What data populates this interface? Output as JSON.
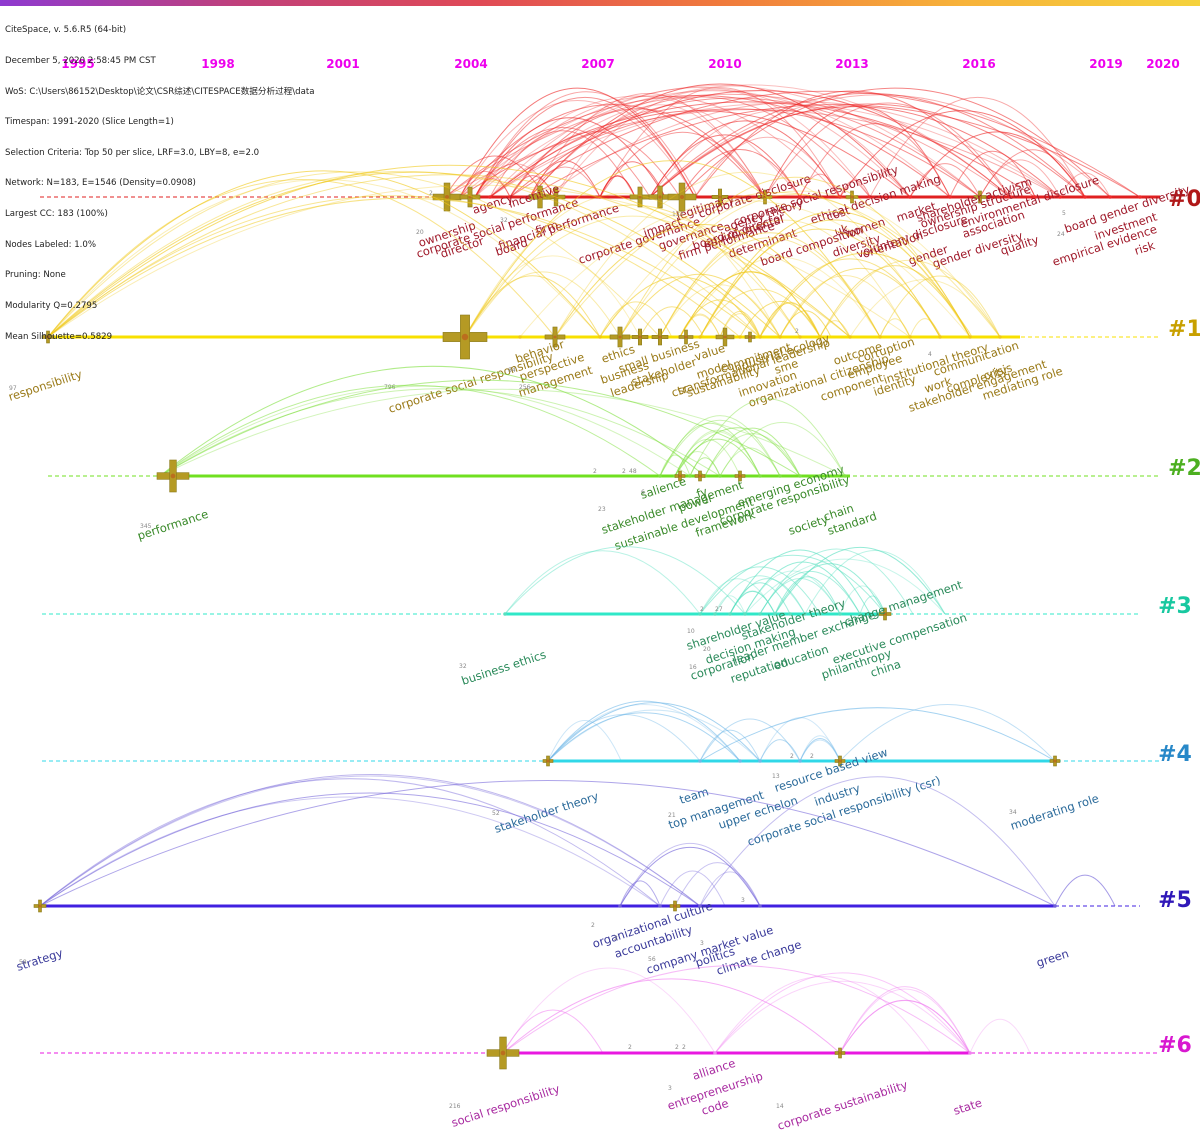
{
  "header_info": [
    "CiteSpace, v. 5.6.R5 (64-bit)",
    "December 5, 2020 2:58:45 PM CST",
    "WoS: C:\\Users\\86152\\Desktop\\论文\\CSR综述\\CITESPACE数据分析过程\\data",
    "Timespan: 1991-2020 (Slice Length=1)",
    "Selection Criteria: Top 50 per slice, LRF=3.0, LBY=8, e=2.0",
    "Network: N=183, E=1546 (Density=0.0908)",
    "Largest CC: 183 (100%)",
    "Nodes Labeled: 1.0%",
    "Pruning: None",
    "Modularity Q=0.2795",
    "Mean Silhouette=0.5829"
  ],
  "years": [
    "1995",
    "1998",
    "2001",
    "2004",
    "2007",
    "2010",
    "2013",
    "2016",
    "2019",
    "2020"
  ],
  "colors": {
    "year_label": "#ee00ee",
    "c0": "#b01818",
    "c1": "#c8a000",
    "c2": "#4caf20",
    "c3": "#18c8a0",
    "c4": "#2888c8",
    "c5": "#3018b8",
    "c6": "#d818d0"
  },
  "clusters": [
    {
      "id": "#0",
      "color": "#b01818",
      "line_color": "#e02020",
      "arc_color": "#ee2a2a",
      "label_color": "#a01a2a",
      "nodes": [
        "ownership",
        "agency",
        "incentive",
        "corporate social performance",
        "director",
        "firm",
        "board",
        "financial performance",
        "corporate governance",
        "impact",
        "legitimacy",
        "corporate disclosure",
        "governance",
        "corporate social responsibility",
        "firm performance",
        "board of director",
        "agency theory",
        "environmental",
        "determinant",
        "board composition",
        "cost",
        "ethical decision making",
        "women",
        "diversity",
        "market",
        "voluntary disclosure",
        "uk",
        "orientation",
        "shareholder activism",
        "ownership structure",
        "environmental disclosure",
        "gender",
        "association",
        "gender diversity",
        "quality",
        "board gender diversity",
        "investment",
        "empirical evidence",
        "risk"
      ],
      "counts": [
        "2",
        "20",
        "133",
        "32",
        "5",
        "24"
      ]
    },
    {
      "id": "#1",
      "color": "#c8a000",
      "line_color": "#f8e000",
      "arc_color": "#f0c818",
      "label_color": "#9a7a18",
      "nodes": [
        "responsibility",
        "corporate social responsibility",
        "perspective",
        "behavior",
        "management",
        "ethics",
        "business",
        "small business",
        "leadership",
        "stakeholder",
        "csr",
        "value",
        "model",
        "transformational leadership",
        "sustainability",
        "commitment",
        "industrial ecology",
        "innovation",
        "sme",
        "organizational citizenship",
        "outcome",
        "corruption",
        "component",
        "employee",
        "identity",
        "institutional theory",
        "communication",
        "work",
        "complexity",
        "crisis",
        "stakeholder engagement",
        "mediating role"
      ],
      "counts": [
        "97",
        "796",
        "84",
        "256",
        "2",
        "4"
      ]
    },
    {
      "id": "#2",
      "color": "#4caf20",
      "line_color": "#70e020",
      "arc_color": "#80e040",
      "label_color": "#3a8a2a",
      "nodes": [
        "performance",
        "salience",
        "fy",
        "stakeholder management",
        "power",
        "sustainable development",
        "emerging economy",
        "framework",
        "corporate responsibility",
        "society",
        "chain",
        "standard"
      ],
      "counts": [
        "345",
        "2",
        "2",
        "48",
        "23",
        "6"
      ]
    },
    {
      "id": "#3",
      "color": "#18c8a0",
      "line_color": "#30e8c8",
      "arc_color": "#58e0c0",
      "label_color": "#2a8a5a",
      "nodes": [
        "business ethics",
        "shareholder value",
        "stakeholder theory",
        "decision making",
        "leader member exchange",
        "change management",
        "corporation",
        "reputation",
        "education",
        "executive compensation",
        "philanthropy",
        "china"
      ],
      "counts": [
        "32",
        "2",
        "27",
        "10",
        "20",
        "16"
      ]
    },
    {
      "id": "#4",
      "color": "#2888c8",
      "line_color": "#30d8e8",
      "arc_color": "#70b8e8",
      "label_color": "#2a6a9a",
      "nodes": [
        "stakeholder theory",
        "team",
        "top management",
        "upper echelon",
        "resource based view",
        "industry",
        "corporate social responsibility (csr)",
        "moderating role"
      ],
      "counts": [
        "52",
        "13",
        "21",
        "34",
        "2",
        "2"
      ]
    },
    {
      "id": "#5",
      "color": "#3018b8",
      "line_color": "#4020e0",
      "arc_color": "#7060d8",
      "label_color": "#3a3a9a",
      "nodes": [
        "strategy",
        "organizational culture",
        "accountability",
        "company market value",
        "politics",
        "climate change",
        "green"
      ],
      "counts": [
        "58",
        "2",
        "2",
        "3",
        "56",
        "3"
      ]
    },
    {
      "id": "#6",
      "color": "#d818d0",
      "line_color": "#e818e0",
      "arc_color": "#f080f0",
      "label_color": "#a82aa0",
      "nodes": [
        "social responsibility",
        "alliance",
        "entrepreneurship",
        "code",
        "corporate sustainability",
        "state"
      ],
      "counts": [
        "216",
        "2",
        "2",
        "14",
        "2",
        "3"
      ]
    }
  ]
}
